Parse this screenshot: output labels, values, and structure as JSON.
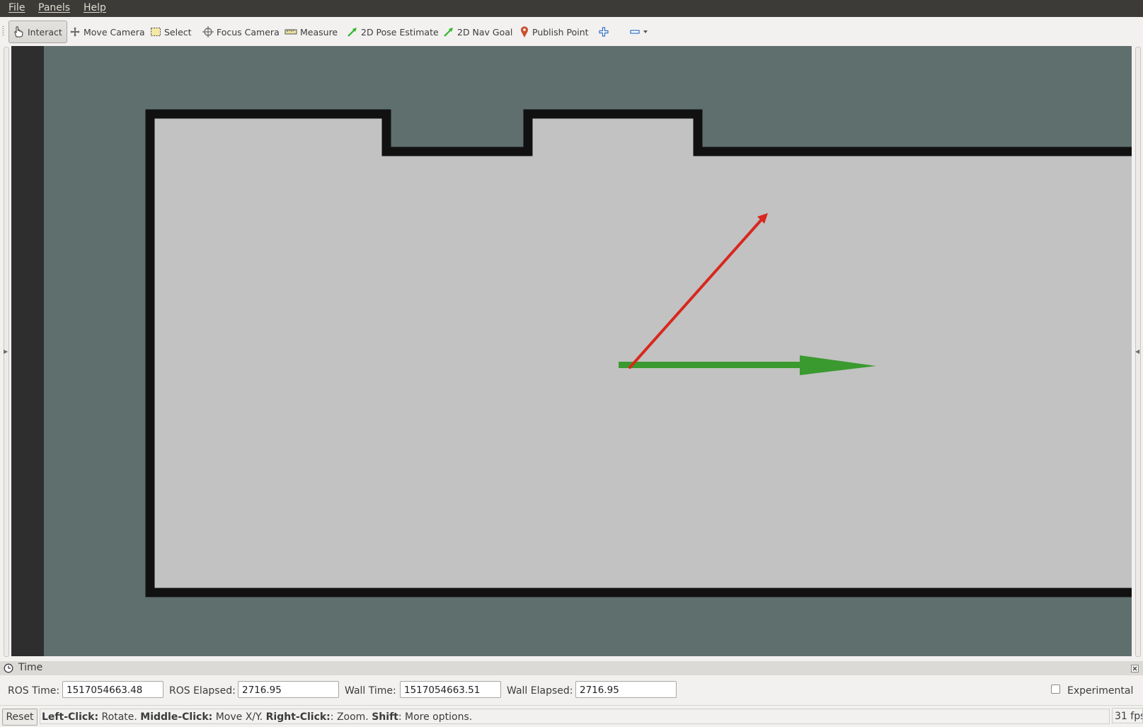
{
  "menu": {
    "file": "File",
    "panels": "Panels",
    "help": "Help"
  },
  "toolbar": {
    "interact": "Interact",
    "move_camera": "Move Camera",
    "select": "Select",
    "focus_camera": "Focus Camera",
    "measure": "Measure",
    "pose_estimate": "2D Pose Estimate",
    "nav_goal": "2D Nav Goal",
    "publish_point": "Publish Point"
  },
  "viewport": {
    "background_color": "#5f6f6e",
    "map_free_color": "#c2c2c2",
    "wall_color": "#111111",
    "x_axis_arrow_color": "#3a9a2f",
    "pose_arrow_color": "#d8281f"
  },
  "time_panel": {
    "title": "Time",
    "ros_time_label": "ROS Time:",
    "ros_time_value": "1517054663.48",
    "ros_elapsed_label": "ROS Elapsed:",
    "ros_elapsed_value": "2716.95",
    "wall_time_label": "Wall Time:",
    "wall_time_value": "1517054663.51",
    "wall_elapsed_label": "Wall Elapsed:",
    "wall_elapsed_value": "2716.95",
    "experimental_label": "Experimental",
    "experimental_checked": false
  },
  "status": {
    "reset_label": "Reset",
    "left_click": "Left-Click:",
    "left_click_desc": " Rotate. ",
    "middle_click": "Middle-Click:",
    "middle_click_desc": " Move X/Y. ",
    "right_click": "Right-Click:",
    "right_click_desc": ": Zoom. ",
    "shift": "Shift",
    "shift_desc": ": More options.",
    "fps": "31 fps"
  }
}
